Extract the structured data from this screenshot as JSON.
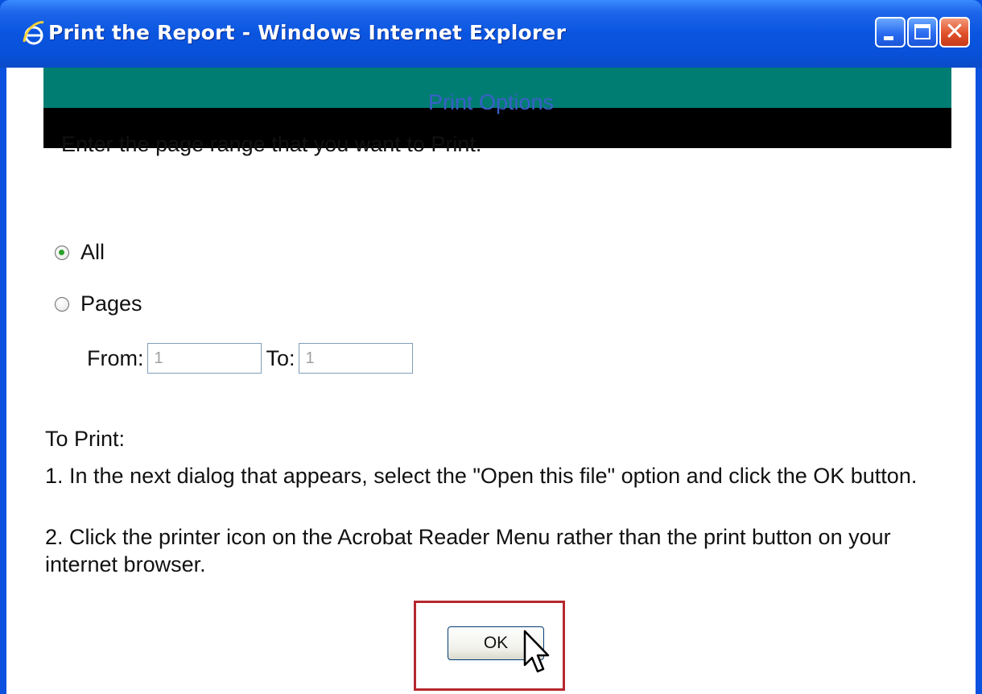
{
  "window": {
    "title": "Print the Report - Windows Internet Explorer"
  },
  "dialog": {
    "heading": "Print Options",
    "instruction": "Enter the page range that you want to Print.",
    "options": [
      {
        "label": "All",
        "selected": true
      },
      {
        "label": "Pages",
        "selected": false
      }
    ],
    "range": {
      "from_label": "From:",
      "from_value": "1",
      "to_label": "To:",
      "to_value": "1"
    },
    "to_print_heading": "To Print:",
    "steps": [
      "1. In the next dialog that appears, select the \"Open this file\" option and click the OK button.",
      "2. Click the printer icon on the Acrobat Reader Menu rather than the print button on your internet browser."
    ],
    "ok_label": "OK"
  },
  "colors": {
    "titlebar": "#0a55e0",
    "band_top": "#007d72",
    "band_bottom": "#000000",
    "heading": "#3a60c8",
    "highlight": "#b5282e"
  }
}
